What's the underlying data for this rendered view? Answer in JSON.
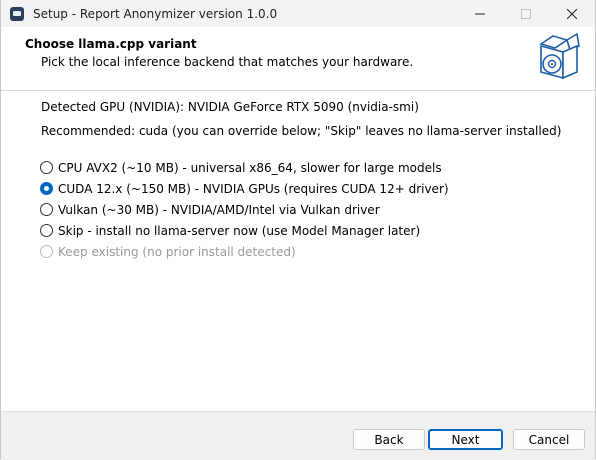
{
  "window": {
    "title": "Setup - Report Anonymizer version 1.0.0",
    "controls": {
      "minimize_icon": "minimize-icon",
      "maximize_icon": "maximize-icon",
      "close_icon": "close-icon"
    }
  },
  "header": {
    "title": "Choose llama.cpp variant",
    "subtitle": "Pick the local inference backend that matches your hardware.",
    "graphic_icon": "installer-box-icon"
  },
  "info": {
    "gpu": "Detected GPU (NVIDIA): NVIDIA GeForce RTX 5090  (nvidia-smi)",
    "recommended": "Recommended: cuda  (you can override below; \"Skip\" leaves no llama-server installed)"
  },
  "options": [
    {
      "label": "CPU AVX2 (~10 MB) - universal x86_64, slower for large models",
      "selected": false,
      "enabled": true
    },
    {
      "label": "CUDA 12.x (~150 MB) - NVIDIA GPUs (requires CUDA 12+ driver)",
      "selected": true,
      "enabled": true
    },
    {
      "label": "Vulkan (~30 MB) - NVIDIA/AMD/Intel via Vulkan driver",
      "selected": false,
      "enabled": true
    },
    {
      "label": "Skip - install no llama-server now (use Model Manager later)",
      "selected": false,
      "enabled": true
    },
    {
      "label": "Keep existing (no prior install detected)",
      "selected": false,
      "enabled": false
    }
  ],
  "buttons": {
    "back": "Back",
    "next": "Next",
    "cancel": "Cancel"
  },
  "colors": {
    "accent": "#0067c0",
    "disabled_text": "#9a9a9a"
  }
}
